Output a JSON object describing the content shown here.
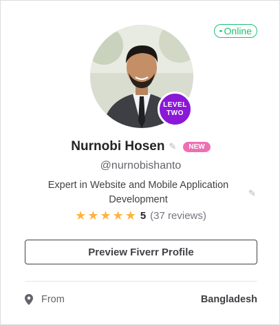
{
  "status": {
    "online_label": "Online",
    "color": "#1dbf73"
  },
  "profile": {
    "level_line1": "LEVEL",
    "level_line2": "TWO",
    "name": "Nurnobi Hosen",
    "new_badge": "NEW",
    "handle": "@nurnobishanto",
    "description": "Expert in Website and Mobile Application Development",
    "rating": {
      "stars": 5,
      "score": "5",
      "reviews": "(37 reviews)"
    }
  },
  "actions": {
    "preview_label": "Preview Fiverr Profile"
  },
  "details": {
    "from_label": "From",
    "from_value": "Bangladesh"
  },
  "icons": {
    "pencil": "pencil-icon",
    "pin": "location-pin-icon",
    "star": "star-icon"
  }
}
